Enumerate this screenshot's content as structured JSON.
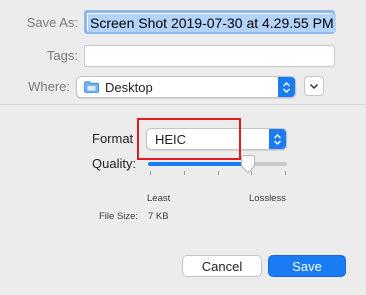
{
  "save_as": {
    "label": "Save As:",
    "value": "Screen Shot 2019-07-30 at 4.29.55 PM"
  },
  "tags": {
    "label": "Tags:",
    "value": ""
  },
  "where": {
    "label": "Where:",
    "value": "Desktop",
    "icon": "folder-icon"
  },
  "format": {
    "label": "Format",
    "value": "HEIC"
  },
  "quality": {
    "label": "Quality:",
    "min_label": "Least",
    "max_label": "Lossless",
    "level": 0.72
  },
  "file_size": {
    "label": "File Size:",
    "value": "7 KB"
  },
  "buttons": {
    "cancel": "Cancel",
    "save": "Save"
  },
  "colors": {
    "accent": "#1a7cf4",
    "highlight": "#e01b24",
    "selection": "#b3d3fb"
  }
}
